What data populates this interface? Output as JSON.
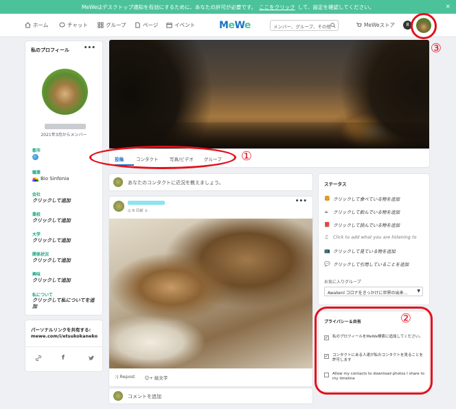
{
  "banner": {
    "text": "MeWeはデスクトップ通知を有効にするために、あなたの許可が必要です。",
    "link": "ここをクリック",
    "text2": "して、設定を確認してください。",
    "close": "×"
  },
  "nav": {
    "home": "ホーム",
    "chat": "チャット",
    "groups": "グループ",
    "pages": "ページ",
    "events": "イベント",
    "logo_m": "M",
    "logo_e": "e",
    "logo_w": "W",
    "logo_e2": "e",
    "search_placeholder": "メンバー、グループ、その他",
    "store": "MeWeストア",
    "bell": "8"
  },
  "profile": {
    "title": "私のプロフィール",
    "more": "•••",
    "since": "2021年3月からメンバー",
    "fields": [
      {
        "label": "都市",
        "value": ""
      },
      {
        "label": "職業",
        "value": "Bio Sinfonia"
      },
      {
        "label": "会社",
        "value": "クリックして追加"
      },
      {
        "label": "業校",
        "value": "クリックして追加"
      },
      {
        "label": "大学",
        "value": "クリックして追加"
      },
      {
        "label": "関係状況",
        "value": "クリックして追加"
      },
      {
        "label": "興味",
        "value": "クリックして追加"
      },
      {
        "label": "私について",
        "value": "クリックして私についてを追加"
      }
    ]
  },
  "share": {
    "label": "パーソナルリンクを共有する:",
    "url": "mewe.com/i/etsukokaneko",
    "icons": [
      "link-icon",
      "facebook-icon",
      "twitter-icon"
    ]
  },
  "tabs": [
    "投稿",
    "コンタクト",
    "写真/ビデオ",
    "グループ"
  ],
  "compose": {
    "placeholder": "あなたのコンタクトに近況を教えましょう。"
  },
  "post": {
    "meta": "◎ 8 日前  ♙·",
    "more": "•••",
    "repost": "Repost",
    "emoji": "絵文字"
  },
  "comment": {
    "placeholder": "コメントを追加"
  },
  "status": {
    "title": "ステータス",
    "rows": [
      {
        "icon": "🍔",
        "text": "クリックして食べている物を追加"
      },
      {
        "icon": "☕",
        "text": "クリックして飲んでいる物を追加"
      },
      {
        "icon": "📕",
        "text": "クリックして読んでいる物を追加"
      },
      {
        "icon": "♫",
        "text": "Click to add what you are listening to"
      },
      {
        "icon": "📺",
        "text": "クリックして見ている物を追加"
      },
      {
        "icon": "💬",
        "text": "クリックして引用していることを追加"
      }
    ],
    "fav_label": "お気に入りグループ",
    "fav_value": "Awakenl コロナをきっかけに世界の出来..."
  },
  "privacy": {
    "title": "プライバシー＆共有",
    "options": [
      {
        "text": "私のプロフィールをMeWe検索に追加してください。",
        "checked": true
      },
      {
        "text": "コンタクトにある人達が私のコンタクトを見ることを許可します",
        "checked": true
      },
      {
        "text": "Allow my contacts to download photos I share to my timeline",
        "checked": false
      }
    ]
  },
  "annotations": [
    "①",
    "②",
    "③"
  ]
}
